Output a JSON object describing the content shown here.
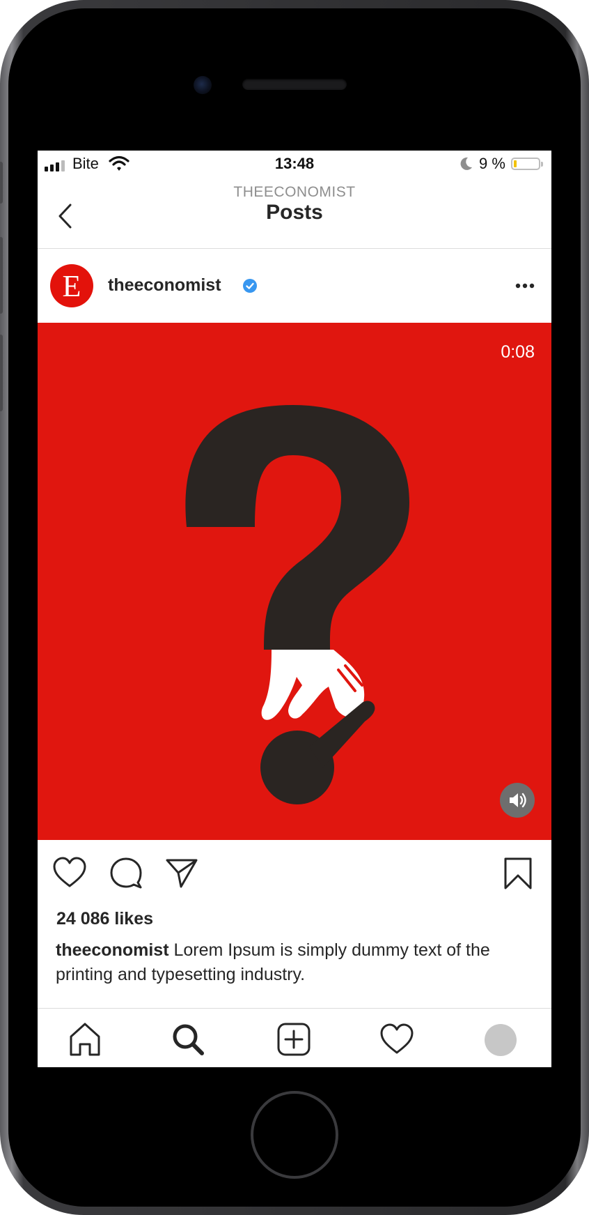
{
  "status_bar": {
    "carrier": "Bite",
    "time": "13:48",
    "battery_percent": "9 %",
    "battery_level": 0.09,
    "icons": [
      "signal-icon",
      "wifi-icon",
      "moon-icon",
      "battery-icon"
    ]
  },
  "nav": {
    "subtitle": "THEECONOMIST",
    "title": "Posts",
    "back_icon": "chevron-left-icon"
  },
  "post": {
    "avatar_letter": "E",
    "username": "theeconomist",
    "verified_icon": "verified-badge-icon",
    "more_icon": "more-horizontal-icon",
    "video_time": "0:08",
    "sound_icon": "speaker-icon",
    "likes": "24 086 likes",
    "caption_user": "theeconomist",
    "caption_text": " Lorem Ipsum is simply dummy text of the printing and typesetting industry.",
    "action_icons": [
      "heart-icon",
      "comment-icon",
      "share-icon",
      "bookmark-icon"
    ]
  },
  "tab_bar": {
    "icons": [
      "home-icon",
      "search-icon",
      "new-post-icon",
      "activity-heart-icon",
      "profile-avatar"
    ]
  },
  "colors": {
    "brand_red": "#e3120b",
    "media_bg": "#e0160f",
    "art_dark": "#2a2522",
    "verified_blue": "#3897f0"
  }
}
